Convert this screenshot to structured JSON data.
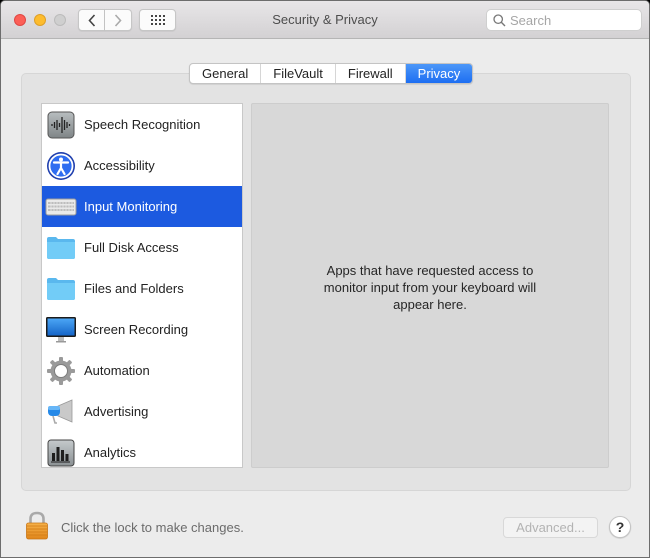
{
  "window": {
    "title": "Security & Privacy"
  },
  "toolbar": {
    "back_label": "‹",
    "forward_label": "›",
    "search_placeholder": "Search",
    "search_value": ""
  },
  "tabs": [
    {
      "label": "General",
      "active": false
    },
    {
      "label": "FileVault",
      "active": false
    },
    {
      "label": "Firewall",
      "active": false
    },
    {
      "label": "Privacy",
      "active": true
    }
  ],
  "privacy_list": {
    "selected_index": 2,
    "items": [
      {
        "label": "Speech Recognition",
        "icon": "speech-recognition-icon"
      },
      {
        "label": "Accessibility",
        "icon": "accessibility-icon"
      },
      {
        "label": "Input Monitoring",
        "icon": "keyboard-icon"
      },
      {
        "label": "Full Disk Access",
        "icon": "folder-icon"
      },
      {
        "label": "Files and Folders",
        "icon": "folder-icon"
      },
      {
        "label": "Screen Recording",
        "icon": "display-icon"
      },
      {
        "label": "Automation",
        "icon": "gear-icon"
      },
      {
        "label": "Advertising",
        "icon": "megaphone-icon"
      },
      {
        "label": "Analytics",
        "icon": "bar-chart-icon"
      }
    ]
  },
  "detail": {
    "message": "Apps that have requested access to monitor input from your keyboard will appear here."
  },
  "footer": {
    "lock_text": "Click the lock to make changes.",
    "advanced_label": "Advanced...",
    "help_label": "?"
  },
  "colors": {
    "accent": "#1c5ae0",
    "tab_active": "#1d6ef2",
    "close": "#fc5f57",
    "minimize": "#fdbc2e"
  }
}
